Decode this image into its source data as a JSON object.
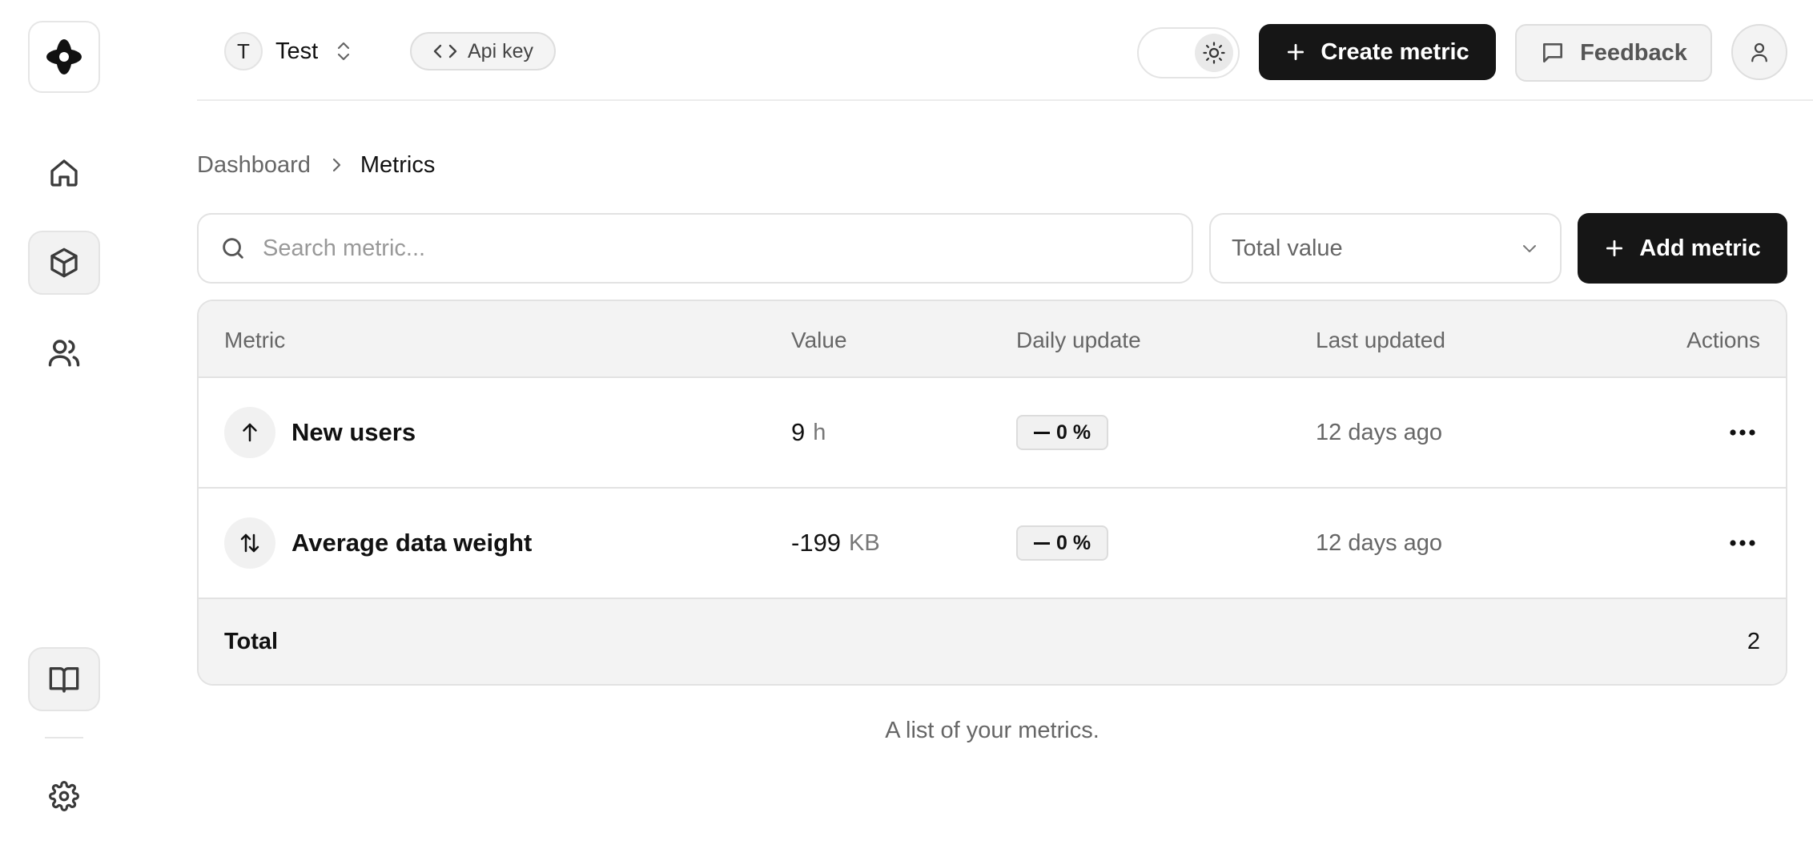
{
  "sidebar": {
    "logo_icon": "app-logo",
    "items": [
      {
        "name": "home",
        "icon": "home-icon",
        "active": false
      },
      {
        "name": "metrics",
        "icon": "box-icon",
        "active": true
      },
      {
        "name": "team",
        "icon": "users-icon",
        "active": false
      }
    ],
    "bottom": [
      {
        "name": "docs",
        "icon": "book-open-icon"
      },
      {
        "name": "settings",
        "icon": "gear-icon"
      }
    ]
  },
  "header": {
    "team_initial": "T",
    "team_name": "Test",
    "api_key_label": "Api key",
    "create_label": "Create metric",
    "feedback_label": "Feedback"
  },
  "breadcrumb": {
    "parent": "Dashboard",
    "current": "Metrics"
  },
  "toolbar": {
    "search_placeholder": "Search metric...",
    "search_value": "",
    "select_value": "Total value",
    "add_label": "Add metric"
  },
  "table": {
    "columns": [
      "Metric",
      "Value",
      "Daily update",
      "Last updated",
      "Actions"
    ],
    "rows": [
      {
        "name": "New users",
        "icon": "arrow-up-icon",
        "value": "9",
        "unit": "h",
        "daily": "0 %",
        "updated": "12 days ago"
      },
      {
        "name": "Average data weight",
        "icon": "arrows-up-down-icon",
        "value": "-199",
        "unit": "KB",
        "daily": "0 %",
        "updated": "12 days ago"
      }
    ],
    "footer_label": "Total",
    "footer_count": "2"
  },
  "caption": "A list of your metrics.",
  "colors": {
    "primary": "#161616",
    "muted_bg": "#f3f3f3",
    "border": "#e2e2e2",
    "muted_text": "#666666"
  }
}
